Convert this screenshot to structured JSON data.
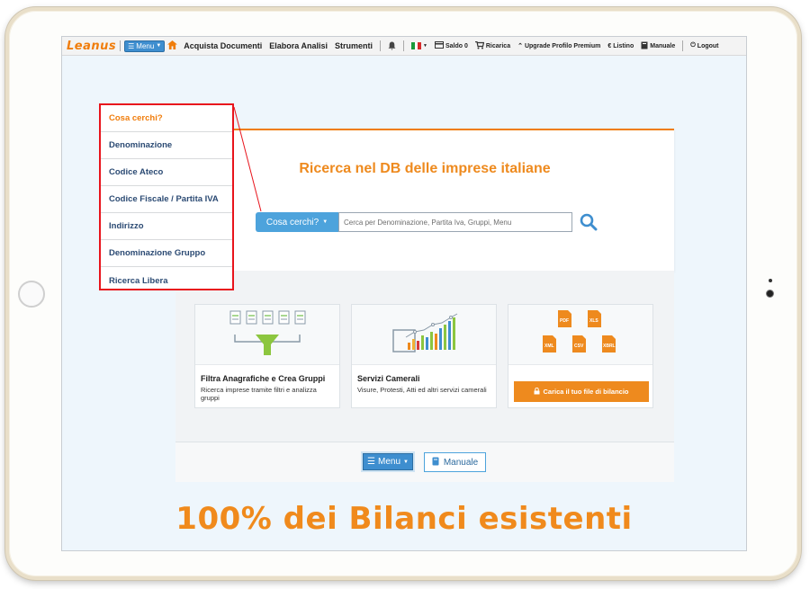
{
  "nav": {
    "logo": "Leanus",
    "menu_label": "Menu",
    "items": [
      "Acquista Documenti",
      "Elabora Analisi",
      "Strumenti"
    ],
    "saldo": "Saldo 0",
    "ricarica": "Ricarica",
    "upgrade": "Upgrade Profilo Premium",
    "listino": "Listino",
    "manuale": "Manuale",
    "logout": "Logout"
  },
  "search": {
    "headline": "Ricerca nel DB delle imprese italiane",
    "button_label": "Cosa cerchi?",
    "placeholder": "Cerca per Denominazione, Partita Iva, Gruppi, Menu"
  },
  "dropdown": {
    "items": [
      "Cosa cerchi?",
      "Denominazione",
      "Codice Ateco",
      "Codice Fiscale / Partita IVA",
      "Indirizzo",
      "Denominazione Gruppo",
      "Ricerca Libera"
    ]
  },
  "tiles": [
    {
      "title": "Filtra Anagrafiche e Crea Gruppi",
      "desc": "Ricerca imprese tramite filtri e analizza gruppi"
    },
    {
      "title": "Servizi Camerali",
      "desc": "Visure, Protesti, Atti ed altri servizi camerali"
    },
    {
      "button": "Carica il tuo file di bilancio",
      "file_types": [
        "PDF",
        "XLS",
        "XML",
        "CSV",
        "XBRL"
      ]
    }
  ],
  "footer": {
    "menu_label": "Menu",
    "manuale_label": "Manuale"
  },
  "tagline": "100% dei Bilanci esistenti",
  "colors": {
    "accent": "#f07d0c",
    "primary_blue": "#3e8ecf",
    "highlight_red": "#e8141c"
  }
}
